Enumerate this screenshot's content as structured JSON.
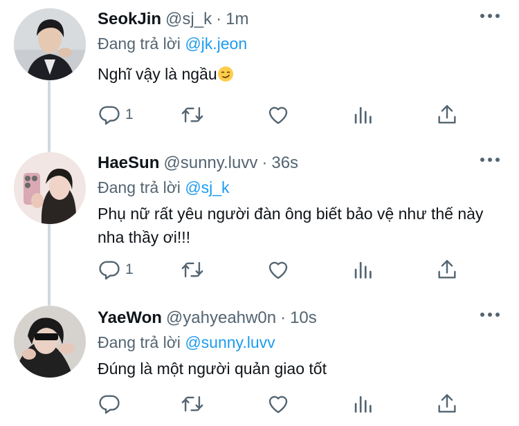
{
  "tweets": [
    {
      "name": "SeokJin",
      "handle": "@sj_k",
      "dot": "·",
      "time": "1m",
      "replying_label": "Đang trả lời",
      "replying_to": "@jk.jeon",
      "text_lines": [
        "Nghĩ vậy là ngầu"
      ],
      "emoji": "smirk-face-emoji",
      "reply_count": "1"
    },
    {
      "name": "HaeSun",
      "handle": "@sunny.luvv",
      "dot": "·",
      "time": "36s",
      "replying_label": "Đang trả lời",
      "replying_to": "@sj_k",
      "text_lines": [
        "Phụ nữ rất yêu người đàn ông biết bảo vệ như thế này",
        "nha thầy ơi!!!"
      ],
      "reply_count": "1"
    },
    {
      "name": "YaeWon",
      "handle": "@yahyeahw0n",
      "dot": "·",
      "time": "10s",
      "replying_label": "Đang trả lời",
      "replying_to": "@sunny.luvv",
      "text_lines": [
        "Đúng là một người quản giao tốt"
      ],
      "reply_count": ""
    }
  ],
  "icons": {
    "reply": "reply-icon",
    "retweet": "retweet-icon",
    "like": "heart-icon",
    "views": "views-icon",
    "share": "share-icon",
    "more": "more-icon"
  },
  "colors": {
    "link": "#1d9bf0",
    "secondary": "#536471",
    "thread_line": "#cfd9de"
  }
}
